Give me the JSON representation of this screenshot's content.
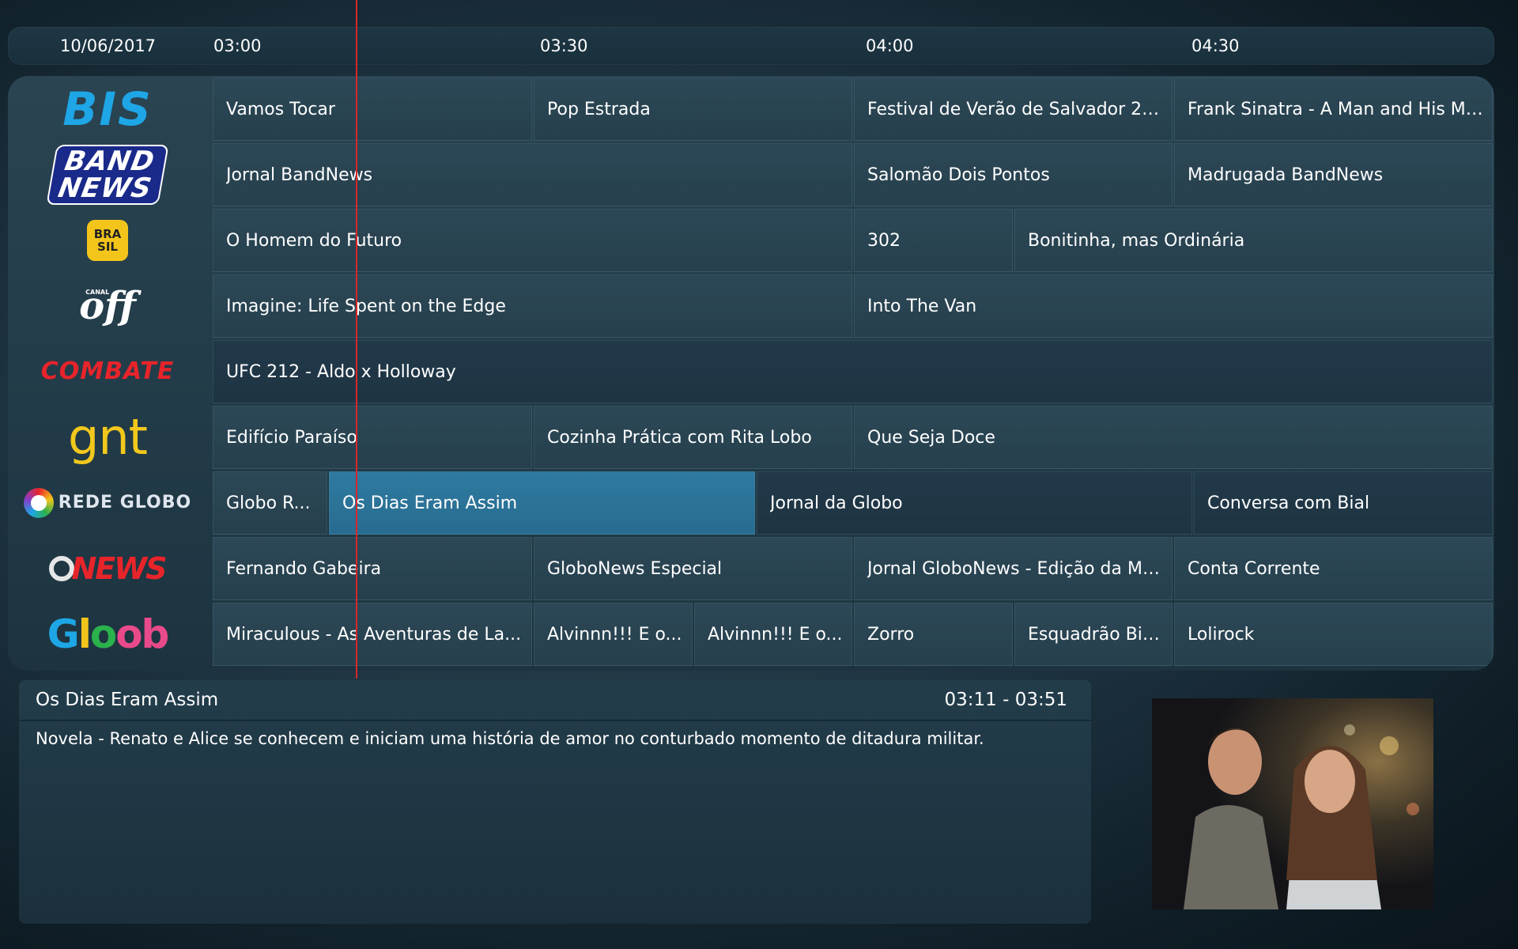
{
  "timebar": {
    "date": "10/06/2017",
    "ticks": [
      "03:00",
      "03:30",
      "04:00",
      "04:30"
    ]
  },
  "channels": [
    {
      "name": "BIS",
      "logo": "bis-logo",
      "programs": [
        {
          "title": "Vamos Tocar"
        },
        {
          "title": "Pop Estrada"
        },
        {
          "title": "Festival de Verão de Salvador 20..."
        },
        {
          "title": "Frank Sinatra - A Man and His Mu..."
        }
      ]
    },
    {
      "name": "BAND NEWS",
      "logo": "bandnews-logo",
      "programs": [
        {
          "title": "Jornal BandNews"
        },
        {
          "title": "Salomão Dois Pontos"
        },
        {
          "title": "Madrugada BandNews"
        }
      ]
    },
    {
      "name": "BRA SIL",
      "logo": "canal-brasil-logo",
      "programs": [
        {
          "title": "O Homem do Futuro"
        },
        {
          "title": "302"
        },
        {
          "title": "Bonitinha, mas Ordinária"
        }
      ]
    },
    {
      "name": "off",
      "logo": "canal-off-logo",
      "programs": [
        {
          "title": "Imagine: Life Spent on the Edge"
        },
        {
          "title": "Into The Van"
        }
      ]
    },
    {
      "name": "COMBATE",
      "logo": "combate-logo",
      "programs": [
        {
          "title": "UFC 212 - Aldo x Holloway"
        }
      ]
    },
    {
      "name": "gnt",
      "logo": "gnt-logo",
      "programs": [
        {
          "title": "Edifício Paraíso"
        },
        {
          "title": "Cozinha Prática com Rita Lobo"
        },
        {
          "title": "Que Seja Doce"
        }
      ]
    },
    {
      "name": "REDE GLOBO",
      "logo": "rede-globo-logo",
      "programs": [
        {
          "title": "Globo R..."
        },
        {
          "title": "Os Dias Eram Assim",
          "selected": true
        },
        {
          "title": "Jornal da Globo"
        },
        {
          "title": "Conversa com Bial"
        }
      ]
    },
    {
      "name": "NEWS",
      "logo": "globonews-logo",
      "programs": [
        {
          "title": "Fernando Gabeira"
        },
        {
          "title": "GloboNews Especial"
        },
        {
          "title": "Jornal GloboNews - Edição da Me..."
        },
        {
          "title": "Conta Corrente"
        }
      ]
    },
    {
      "name": "Gloob",
      "logo": "gloob-logo",
      "programs": [
        {
          "title": "Miraculous - As Aventuras de La..."
        },
        {
          "title": "Alvinnn!!! E o..."
        },
        {
          "title": "Alvinnn!!! E o..."
        },
        {
          "title": "Zorro"
        },
        {
          "title": "Esquadrão Biz..."
        },
        {
          "title": "Lolirock"
        }
      ]
    }
  ],
  "info": {
    "title": "Os Dias Eram Assim",
    "time": "03:11 - 03:51",
    "description": "Novela - Renato e Alice se conhecem e iniciam uma história de amor no conturbado momento de ditadura militar."
  },
  "colors": {
    "selected": "#2f7aa0",
    "now_line": "#d8262b"
  }
}
